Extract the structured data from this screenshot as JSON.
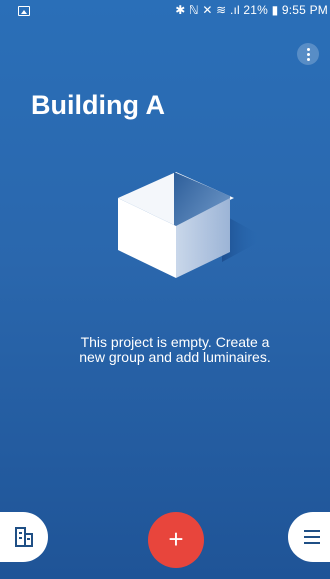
{
  "status_bar": {
    "indicators": "✱ ℕ ✕ ≋ .ıl 21% ▮ 9:55 PM"
  },
  "header": {
    "title": "Building A"
  },
  "empty_state": {
    "line1": "This project is empty. Create a",
    "line2": "new group and add luminaires."
  },
  "fab": {
    "add_label": "+"
  },
  "icons": {
    "status_image": "image-icon",
    "more": "more-vert-icon",
    "building": "building-icon",
    "add": "plus-icon",
    "menu": "menu-icon"
  },
  "colors": {
    "background": "#2a6fb8",
    "accent": "#e8453c",
    "dark_icon": "#1f4f85"
  }
}
